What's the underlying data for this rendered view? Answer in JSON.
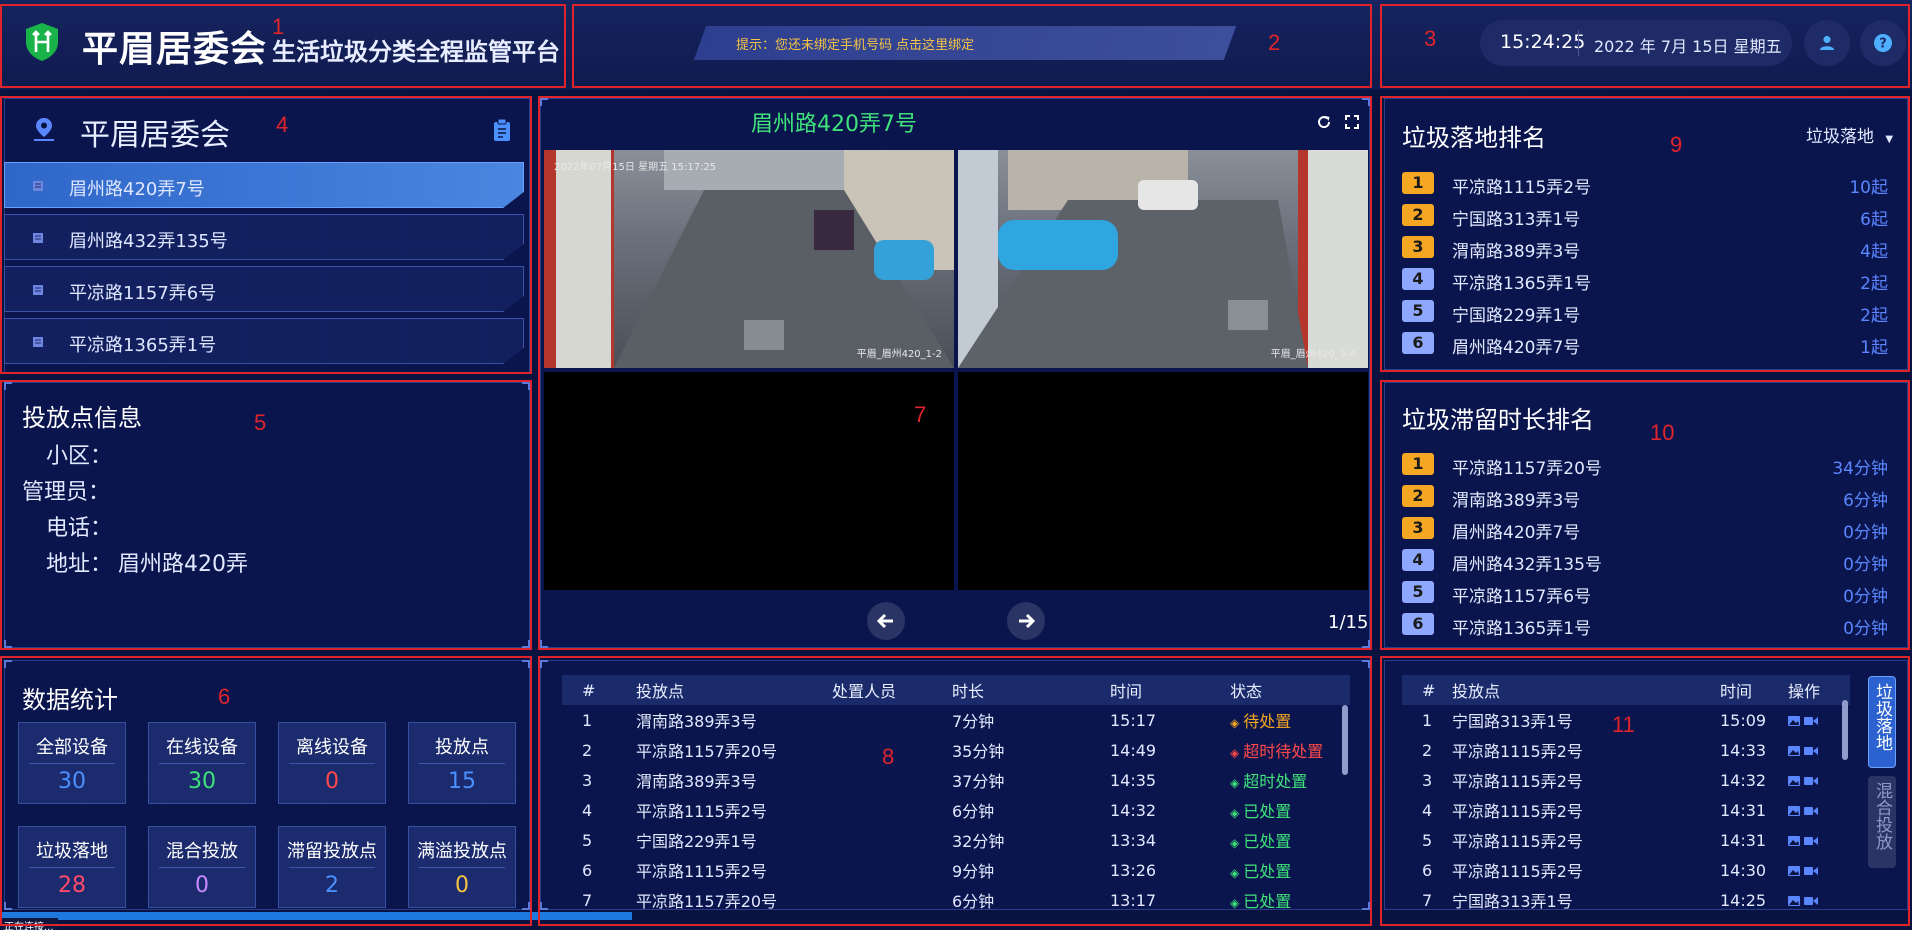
{
  "header": {
    "title_main": "平眉居委会",
    "title_sub": "生活垃圾分类全程监管平台",
    "tip": "提示：您还未绑定手机号码 点击这里绑定",
    "time": "15:24:25",
    "date": "2022 年 7月 15日 星期五"
  },
  "annotations": [
    "1",
    "2",
    "3",
    "4",
    "5",
    "6",
    "7",
    "8",
    "9",
    "10",
    "11"
  ],
  "community": {
    "title": "平眉居委会",
    "items": [
      "眉州路420弄7号",
      "眉州路432弄135号",
      "平凉路1157弄6号",
      "平凉路1365弄1号"
    ]
  },
  "info": {
    "title": "投放点信息",
    "rows": [
      {
        "label": "小区：",
        "value": ""
      },
      {
        "label": "管理员：",
        "value": ""
      },
      {
        "label": "电话：",
        "value": ""
      },
      {
        "label": "地址：",
        "value": "眉州路420弄"
      }
    ]
  },
  "stats": {
    "title": "数据统计",
    "cards": [
      {
        "label": "全部设备",
        "value": "30",
        "color": "#4a90ff"
      },
      {
        "label": "在线设备",
        "value": "30",
        "color": "#3fe27a"
      },
      {
        "label": "离线设备",
        "value": "0",
        "color": "#ff4a4a"
      },
      {
        "label": "投放点",
        "value": "15",
        "color": "#4a90ff"
      },
      {
        "label": "垃圾落地",
        "value": "28",
        "color": "#ff4a6a"
      },
      {
        "label": "混合投放",
        "value": "0",
        "color": "#c88aff"
      },
      {
        "label": "滞留投放点",
        "value": "2",
        "color": "#4a90ff"
      },
      {
        "label": "满溢投放点",
        "value": "0",
        "color": "#f5c444"
      }
    ]
  },
  "video": {
    "title": "眉州路420弄7号",
    "cams": [
      {
        "stamp": "2022年07月15日 星期五 15:17:25",
        "foot": "平眉_眉州420_1-2"
      },
      {
        "stamp": "",
        "foot": "平眉_眉州420_3-4"
      }
    ],
    "page": "1/15"
  },
  "events": {
    "headers": [
      "#",
      "投放点",
      "处置人员",
      "时长",
      "时间",
      "状态"
    ],
    "rows": [
      {
        "n": "1",
        "point": "渭南路389弄3号",
        "staff": "",
        "dur": "7分钟",
        "time": "15:17",
        "status": "待处置",
        "cls": "st-wait",
        "mark": "◈"
      },
      {
        "n": "2",
        "point": "平凉路1157弄20号",
        "staff": "",
        "dur": "35分钟",
        "time": "14:49",
        "status": "超时待处置",
        "cls": "st-over",
        "mark": "◈"
      },
      {
        "n": "3",
        "point": "渭南路389弄3号",
        "staff": "",
        "dur": "37分钟",
        "time": "14:35",
        "status": "超时处置",
        "cls": "st-overdone",
        "mark": "◈"
      },
      {
        "n": "4",
        "point": "平凉路1115弄2号",
        "staff": "",
        "dur": "6分钟",
        "time": "14:32",
        "status": "已处置",
        "cls": "st-done",
        "mark": "◈"
      },
      {
        "n": "5",
        "point": "宁国路229弄1号",
        "staff": "",
        "dur": "32分钟",
        "time": "13:34",
        "status": "已处置",
        "cls": "st-done",
        "mark": "◈"
      },
      {
        "n": "6",
        "point": "平凉路1115弄2号",
        "staff": "",
        "dur": "9分钟",
        "time": "13:26",
        "status": "已处置",
        "cls": "st-done",
        "mark": "◈"
      },
      {
        "n": "7",
        "point": "平凉路1157弄20号",
        "staff": "",
        "dur": "6分钟",
        "time": "13:17",
        "status": "已处置",
        "cls": "st-done",
        "mark": "◈"
      }
    ]
  },
  "rank_drop": {
    "title": "垃圾落地排名",
    "filter": "垃圾落地",
    "rows": [
      {
        "n": "1",
        "name": "平凉路1115弄2号",
        "val": "10起"
      },
      {
        "n": "2",
        "name": "宁国路313弄1号",
        "val": "6起"
      },
      {
        "n": "3",
        "name": "渭南路389弄3号",
        "val": "4起"
      },
      {
        "n": "4",
        "name": "平凉路1365弄1号",
        "val": "2起"
      },
      {
        "n": "5",
        "name": "宁国路229弄1号",
        "val": "2起"
      },
      {
        "n": "6",
        "name": "眉州路420弄7号",
        "val": "1起"
      }
    ]
  },
  "rank_stay": {
    "title": "垃圾滞留时长排名",
    "rows": [
      {
        "n": "1",
        "name": "平凉路1157弄20号",
        "val": "34分钟"
      },
      {
        "n": "2",
        "name": "渭南路389弄3号",
        "val": "6分钟"
      },
      {
        "n": "3",
        "name": "眉州路420弄7号",
        "val": "0分钟"
      },
      {
        "n": "4",
        "name": "眉州路432弄135号",
        "val": "0分钟"
      },
      {
        "n": "5",
        "name": "平凉路1157弄6号",
        "val": "0分钟"
      },
      {
        "n": "6",
        "name": "平凉路1365弄1号",
        "val": "0分钟"
      }
    ]
  },
  "log": {
    "headers": [
      "#",
      "投放点",
      "时间",
      "操作"
    ],
    "rows": [
      {
        "n": "1",
        "point": "宁国路313弄1号",
        "time": "15:09"
      },
      {
        "n": "2",
        "point": "平凉路1115弄2号",
        "time": "14:33"
      },
      {
        "n": "3",
        "point": "平凉路1115弄2号",
        "time": "14:32"
      },
      {
        "n": "4",
        "point": "平凉路1115弄2号",
        "time": "14:31"
      },
      {
        "n": "5",
        "point": "平凉路1115弄2号",
        "time": "14:31"
      },
      {
        "n": "6",
        "point": "平凉路1115弄2号",
        "time": "14:30"
      },
      {
        "n": "7",
        "point": "宁国路313弄1号",
        "time": "14:25"
      }
    ],
    "tabs": [
      "垃圾落地",
      "混合投放"
    ]
  },
  "status_tip": "正在连接..."
}
